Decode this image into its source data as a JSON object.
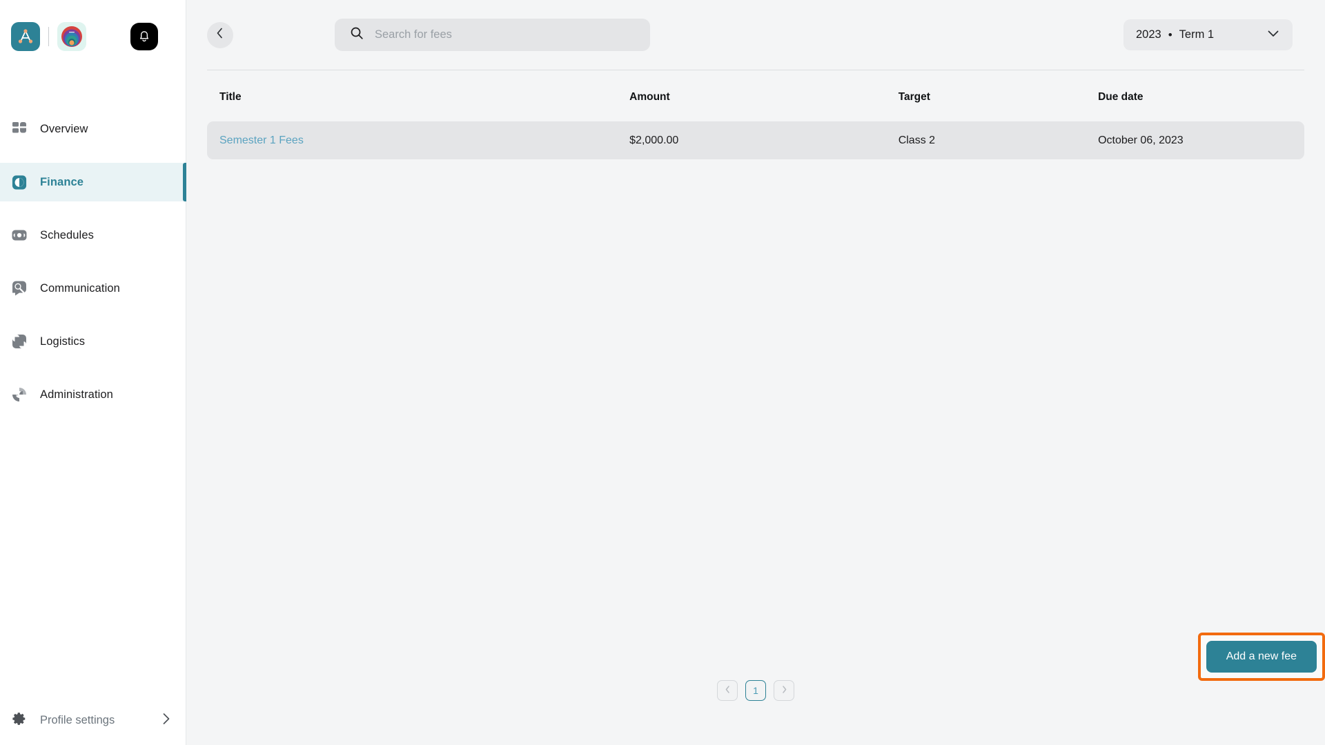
{
  "brand": {
    "logo_letter": "A",
    "logo_icon": "logo-a-mark",
    "secondary_logo_icon": "rainbow-arcs-logo",
    "notification_icon": "bell-icon"
  },
  "sidebar": {
    "items": [
      {
        "label": "Overview",
        "icon": "dashboard-icon",
        "active": false
      },
      {
        "label": "Finance",
        "icon": "finance-pie-icon",
        "active": true
      },
      {
        "label": "Schedules",
        "icon": "schedules-icon",
        "active": false
      },
      {
        "label": "Communication",
        "icon": "communication-icon",
        "active": false
      },
      {
        "label": "Logistics",
        "icon": "logistics-truck-icon",
        "active": false
      },
      {
        "label": "Administration",
        "icon": "administration-icon",
        "active": false
      }
    ],
    "footer": {
      "label": "Profile settings",
      "icon": "gear-icon",
      "chevron": "chevron-right-icon"
    }
  },
  "topbar": {
    "back_icon": "chevron-left-icon",
    "search": {
      "icon": "search-icon",
      "placeholder": "Search for fees",
      "value": ""
    },
    "term_selector": {
      "year": "2023",
      "separator": "•",
      "term": "Term 1",
      "chevron": "chevron-down-icon"
    }
  },
  "table": {
    "columns": [
      "Title",
      "Amount",
      "Target",
      "Due date"
    ],
    "rows": [
      {
        "title": "Semester 1 Fees",
        "amount": "$2,000.00",
        "target": "Class 2",
        "due_date": "October 06, 2023"
      }
    ]
  },
  "pagination": {
    "prev_icon": "chevron-left-icon",
    "next_icon": "chevron-right-icon",
    "pages": [
      "1"
    ],
    "current": "1"
  },
  "actions": {
    "add_fee_label": "Add a new fee"
  },
  "colors": {
    "accent_teal": "#2d8296",
    "highlight_orange": "#f26b0f",
    "link_blue": "#5ba3c0",
    "main_bg": "#f4f5f6",
    "row_bg": "#e4e5e7"
  }
}
